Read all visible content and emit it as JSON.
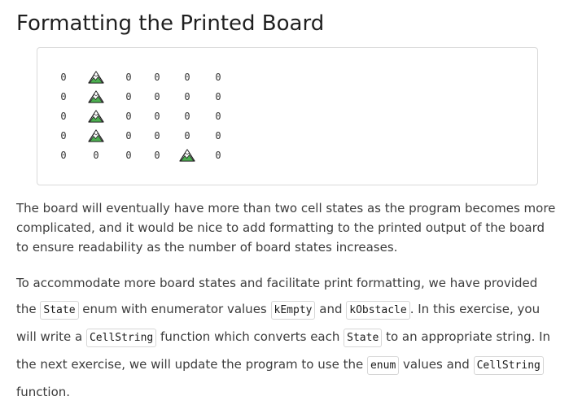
{
  "title": "Formatting the Printed Board",
  "board": {
    "rows": [
      [
        "0",
        "mountain",
        "0",
        "0",
        "0",
        "0"
      ],
      [
        "0",
        "mountain",
        "0",
        "0",
        "0",
        "0"
      ],
      [
        "0",
        "mountain",
        "0",
        "0",
        "0",
        "0"
      ],
      [
        "0",
        "mountain",
        "0",
        "0",
        "0",
        "0"
      ],
      [
        "0",
        "0",
        "0",
        "0",
        "mountain",
        "0"
      ]
    ],
    "icon": "mountain-icon"
  },
  "paragraph1": "The board will eventually have more than two cell states as the program becomes more complicated, and it would be nice to add formatting to the printed output of the board to ensure readability as the number of board states increases.",
  "paragraph2": {
    "t1": "To accommodate more board states and facilitate print formatting, we have provided the ",
    "c1": "State",
    "t2": " enum with enumerator values ",
    "c2": "kEmpty",
    "t3": " and ",
    "c3": "kObstacle",
    "t4": ". In this exercise, you will write a ",
    "c4": "CellString",
    "t5": " function which converts each ",
    "c5": "State",
    "t6": " to an appropriate string. In the next exercise, we will update the program to use the ",
    "c6": "enum",
    "t7": " values and ",
    "c7": "CellString",
    "t8": " function."
  }
}
